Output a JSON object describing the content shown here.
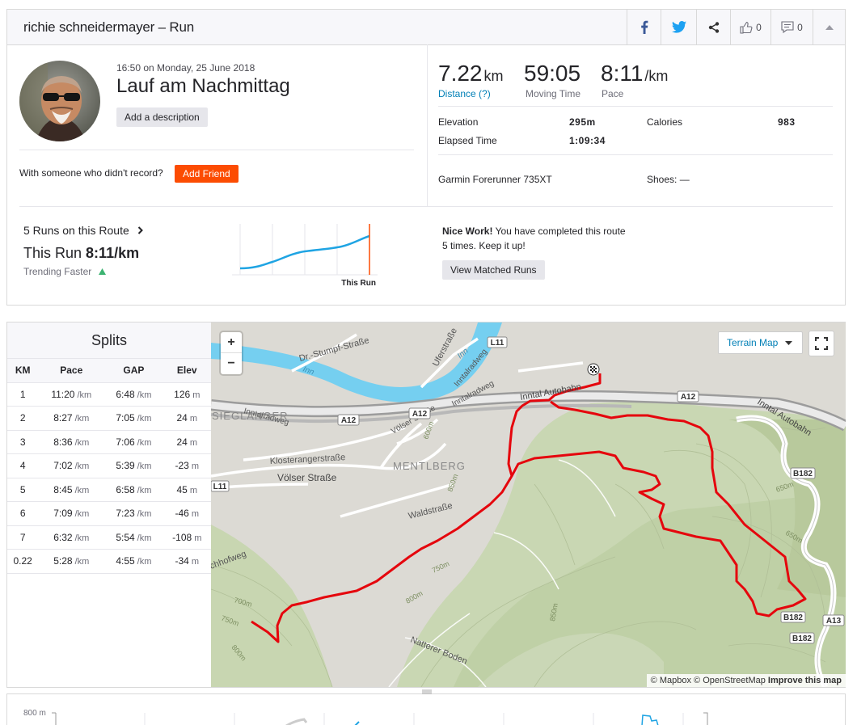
{
  "header": {
    "title": "richie schneidermayer – Run",
    "kudos_count": "0",
    "comment_count": "0"
  },
  "activity": {
    "timestamp": "16:50 on Monday, 25 June 2018",
    "name": "Lauf am Nachmittag",
    "add_description": "Add a description",
    "with_someone": "With someone who didn't record?",
    "add_friend": "Add Friend"
  },
  "stats": {
    "distance": "7.22",
    "distance_unit": "km",
    "distance_label": "Distance (?)",
    "moving_time": "59:05",
    "moving_time_label": "Moving Time",
    "pace": "8:11",
    "pace_unit": "/km",
    "pace_label": "Pace",
    "elevation_label": "Elevation",
    "elevation": "295m",
    "calories_label": "Calories",
    "calories": "983",
    "elapsed_label": "Elapsed Time",
    "elapsed": "1:09:34",
    "device": "Garmin Forerunner 735XT",
    "shoes": "Shoes: —"
  },
  "route": {
    "runs_on_route": "5 Runs on this Route",
    "this_run_prefix": "This Run",
    "this_run_pace": "8:11/km",
    "trend": "Trending Faster",
    "chart_marker_label": "This Run",
    "nice_work_bold": "Nice Work!",
    "nice_work_text": "You have completed this route 5 times. Keep it up!",
    "view_matched": "View Matched Runs"
  },
  "splits": {
    "title": "Splits",
    "headers": [
      "KM",
      "Pace",
      "GAP",
      "Elev"
    ],
    "pace_unit": "/km",
    "elev_unit": "m",
    "rows": [
      {
        "km": "1",
        "pace": "11:20",
        "gap": "6:48",
        "elev": "126"
      },
      {
        "km": "2",
        "pace": "8:27",
        "gap": "7:05",
        "elev": "24"
      },
      {
        "km": "3",
        "pace": "8:36",
        "gap": "7:06",
        "elev": "24"
      },
      {
        "km": "4",
        "pace": "7:02",
        "gap": "5:39",
        "elev": "-23"
      },
      {
        "km": "5",
        "pace": "8:45",
        "gap": "6:58",
        "elev": "45"
      },
      {
        "km": "6",
        "pace": "7:09",
        "gap": "7:23",
        "elev": "-46"
      },
      {
        "km": "7",
        "pace": "6:32",
        "gap": "5:54",
        "elev": "-108"
      },
      {
        "km": "0.22",
        "pace": "5:28",
        "gap": "4:55",
        "elev": "-34"
      }
    ]
  },
  "map": {
    "layer": "Terrain Map",
    "zoom_in": "+",
    "zoom_out": "−",
    "attrib_mapbox": "© Mapbox",
    "attrib_osm": "© OpenStreetMap",
    "attrib_improve": "Improve this map",
    "labels": {
      "inn1": "Inn",
      "inn2": "Inn",
      "uferstrasse": "Uferstraße",
      "stumpf": "Dr.-Stumpf-Straße",
      "l11a": "L11",
      "l11b": "L11",
      "inntalradweg1": "Inntalradweg",
      "inntalradweg2": "Inntalradweg",
      "inntalradweg3": "Inntalradweg",
      "autobahn1": "Inntal Autobahn",
      "autobahn2": "Inntal Autobahn",
      "a12a": "A12",
      "a12b": "A12",
      "a12c": "A12",
      "sieglanger": "SIEGLANGER",
      "volserstr2": "Völser Straße",
      "kloster": "Klosterangerstraße",
      "mentlberg": "MENTLBERG",
      "volserstr": "Völser Straße",
      "waldstr": "Waldstraße",
      "hofweg": "chhofweg",
      "natterer": "Natterer Boden",
      "b182a": "B182",
      "b182b": "B182",
      "b182c": "B182",
      "a13": "A13",
      "c600": "600m",
      "c650a": "650m",
      "c650b": "650m",
      "c700": "700m",
      "c750": "750m",
      "c750b": "750m",
      "c800": "800m",
      "c800b": "800m",
      "c850": "850m",
      "c850b": "850m"
    }
  },
  "elevation_chart": {
    "top_label": "800 m"
  },
  "colors": {
    "brand": "#fc4c02",
    "route": "#e5060d",
    "trend": "#1fa4e3",
    "link": "#007fb6"
  }
}
